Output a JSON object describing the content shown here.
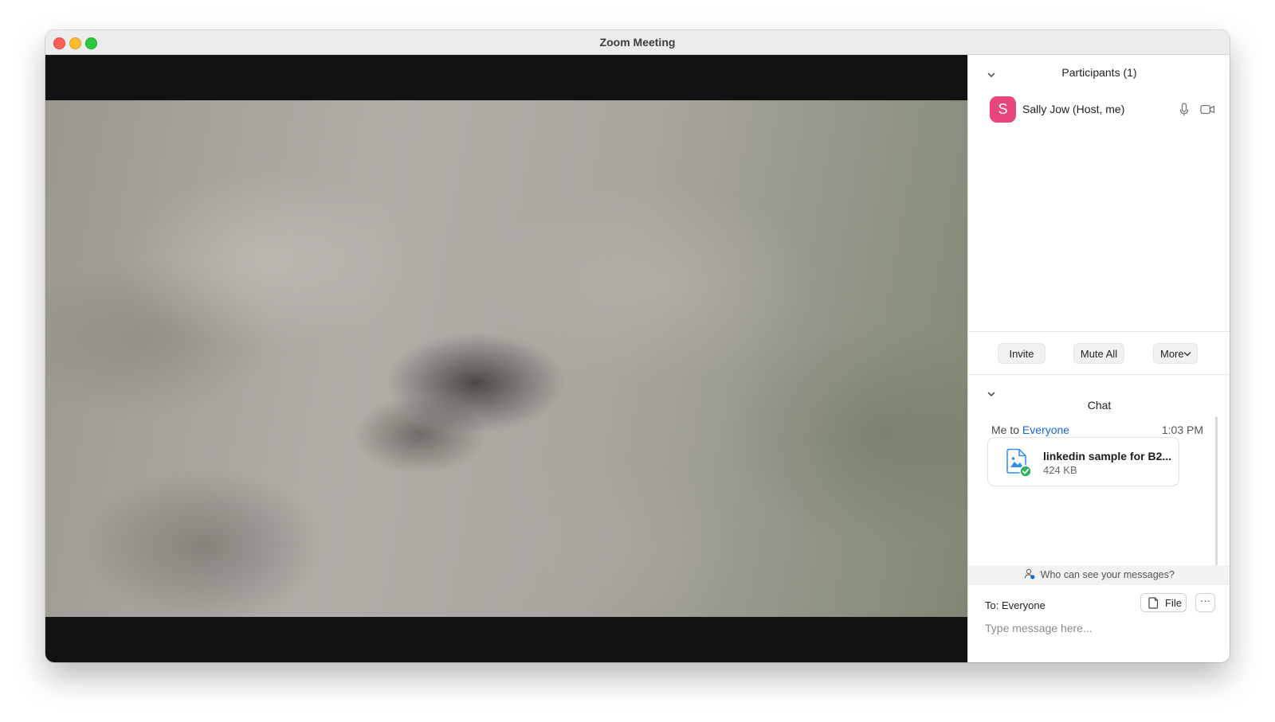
{
  "window": {
    "title": "Zoom Meeting"
  },
  "participants": {
    "header": "Participants (1)",
    "list": [
      {
        "initial": "S",
        "name": "Sally Jow (Host, me)",
        "avatar_color": "#e8457a"
      }
    ],
    "buttons": {
      "invite": "Invite",
      "mute_all": "Mute All",
      "more": "More"
    }
  },
  "chat": {
    "header": "Chat",
    "messages": [
      {
        "from": "Me to",
        "to": "Everyone",
        "time": "1:03 PM",
        "file_name": "linkedin sample for B2...",
        "file_size": "424 KB"
      }
    ],
    "privacy_note": "Who can see your messages?",
    "to_label": "To: Everyone",
    "file_button": "File",
    "more_button": "···",
    "input_placeholder": "Type message here..."
  },
  "colors": {
    "accent_link": "#1a67d8",
    "file_icon": "#2d8cf0",
    "check": "#2fb35c"
  }
}
